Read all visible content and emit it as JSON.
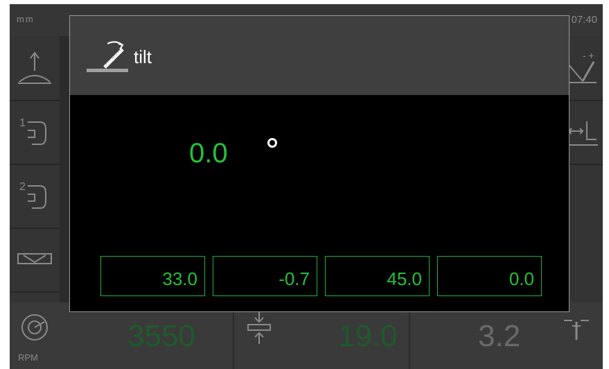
{
  "topbar": {
    "unit": "mm",
    "time": "07:40"
  },
  "dialog": {
    "title": "tilt",
    "icon": "tilt-blade-icon"
  },
  "angle": {
    "value": "0.0",
    "unit_symbol": "degree-ring"
  },
  "presets": [
    "33.0",
    "-0.7",
    "45.0",
    "0.0"
  ],
  "bottom": {
    "rpm_label": "RPM",
    "rpm_value": "3550",
    "thickness_value": "19.0",
    "right_value": "3.2"
  },
  "colors": {
    "accent_green": "#23c23a",
    "dim_green": "#1f5a2c",
    "header": "#3f3f3f"
  }
}
